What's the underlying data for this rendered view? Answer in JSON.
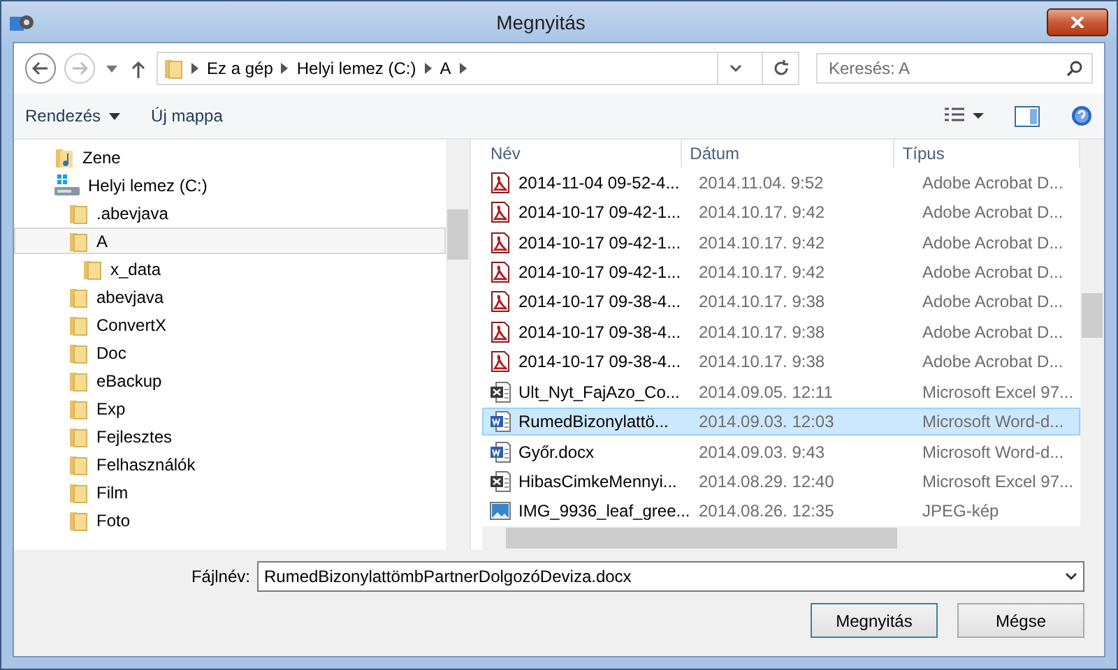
{
  "window": {
    "title": "Megnyitás"
  },
  "navigation": {
    "breadcrumbs": [
      "Ez a gép",
      "Helyi lemez (C:)",
      "A"
    ],
    "search": {
      "placeholder": "Keresés: A"
    }
  },
  "toolbar": {
    "items": [
      "Rendezés",
      "Új mappa"
    ]
  },
  "sidebar": {
    "items": [
      {
        "label": "Zene",
        "kind": "music",
        "selected": false
      },
      {
        "label": "Helyi lemez (C:)",
        "kind": "drive",
        "selected": false,
        "children": [
          {
            "label": ".abevjava",
            "kind": "folder",
            "selected": false
          },
          {
            "label": "A",
            "kind": "folder",
            "selected": true,
            "children": [
              {
                "label": "x_data",
                "kind": "folder",
                "selected": false
              }
            ]
          },
          {
            "label": "abevjava",
            "kind": "folder",
            "selected": false
          },
          {
            "label": "ConvertX",
            "kind": "folder",
            "selected": false
          },
          {
            "label": "Doc",
            "kind": "folder",
            "selected": false
          },
          {
            "label": "eBackup",
            "kind": "folder",
            "selected": false
          },
          {
            "label": "Exp",
            "kind": "folder",
            "selected": false
          },
          {
            "label": "Fejlesztes",
            "kind": "folder",
            "selected": false
          },
          {
            "label": "Felhasználók",
            "kind": "folder",
            "selected": false
          },
          {
            "label": "Film",
            "kind": "folder",
            "selected": false
          },
          {
            "label": "Foto",
            "kind": "folder",
            "selected": false
          }
        ]
      }
    ]
  },
  "table": {
    "columns": [
      "Név",
      "Dátum",
      "Típus"
    ],
    "rows": [
      {
        "kind": "pdf",
        "name": "2014-11-04 09-52-4...",
        "date": "2014.11.04. 9:52",
        "type": "Adobe Acrobat D...",
        "selected": false
      },
      {
        "kind": "pdf",
        "name": "2014-10-17 09-42-1...",
        "date": "2014.10.17. 9:42",
        "type": "Adobe Acrobat D...",
        "selected": false
      },
      {
        "kind": "pdf",
        "name": "2014-10-17 09-42-1...",
        "date": "2014.10.17. 9:42",
        "type": "Adobe Acrobat D...",
        "selected": false
      },
      {
        "kind": "pdf",
        "name": "2014-10-17 09-42-1...",
        "date": "2014.10.17. 9:42",
        "type": "Adobe Acrobat D...",
        "selected": false
      },
      {
        "kind": "pdf",
        "name": "2014-10-17 09-38-4...",
        "date": "2014.10.17. 9:38",
        "type": "Adobe Acrobat D...",
        "selected": false
      },
      {
        "kind": "pdf",
        "name": "2014-10-17 09-38-4...",
        "date": "2014.10.17. 9:38",
        "type": "Adobe Acrobat D...",
        "selected": false
      },
      {
        "kind": "pdf",
        "name": "2014-10-17 09-38-4...",
        "date": "2014.10.17. 9:38",
        "type": "Adobe Acrobat D...",
        "selected": false
      },
      {
        "kind": "excel",
        "name": "Ult_Nyt_FajAzo_Co...",
        "date": "2014.09.05. 12:11",
        "type": "Microsoft Excel 97...",
        "selected": false
      },
      {
        "kind": "word",
        "name": "RumedBizonylattö...",
        "date": "2014.09.03. 12:03",
        "type": "Microsoft Word-d...",
        "selected": true
      },
      {
        "kind": "word",
        "name": "Győr.docx",
        "date": "2014.09.03. 9:43",
        "type": "Microsoft Word-d...",
        "selected": false
      },
      {
        "kind": "excel",
        "name": "HibasCimkeMennyi...",
        "date": "2014.08.29. 12:40",
        "type": "Microsoft Excel 97...",
        "selected": false
      },
      {
        "kind": "image",
        "name": "IMG_9936_leaf_gree...",
        "date": "2014.08.26. 12:35",
        "type": "JPEG-kép",
        "selected": false
      }
    ]
  },
  "filename": {
    "label": "Fájlnév:",
    "value": "RumedBizonylattömbPartnerDolgozóDeviza.docx"
  },
  "buttons": [
    "Megnyitás",
    "Mégse"
  ]
}
